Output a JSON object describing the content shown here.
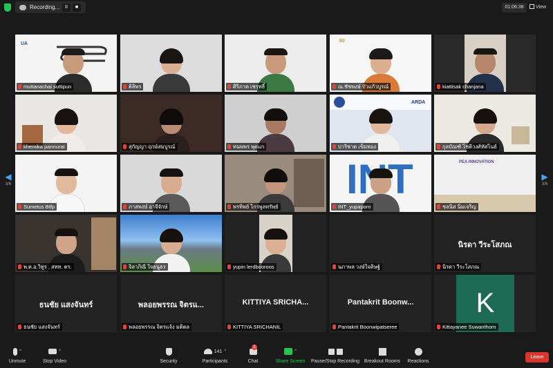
{
  "topbar": {
    "recording_label": "Recording...",
    "pause_symbol": "II",
    "stop_symbol": "■",
    "timer": "01:06:38",
    "view_label": "View"
  },
  "pager": {
    "left_page": "3/6",
    "right_page": "3/6"
  },
  "participants": [
    {
      "name": "muttanachai suttipun",
      "video": true
    },
    {
      "name": "ติลิพร",
      "video": true
    },
    {
      "name": "ศิริภาค เชรุทธิ์",
      "video": true
    },
    {
      "name": "ณ.ชัชพงษ์ บัวแก้วบูรณ์",
      "video": true
    },
    {
      "name": "kiattisak chanjana",
      "video": true
    },
    {
      "name": "khemika pannurat",
      "video": true
    },
    {
      "name": "สุกัญญา ฤกษ์สมบูรณ์",
      "video": true
    },
    {
      "name": "ทนพพร พุดแก",
      "video": true
    },
    {
      "name": "ปาริชาต เข็มทอง",
      "video": true
    },
    {
      "name": "กุลบัณฑ์ โชติวงศ์ทัศไนย์",
      "video": true
    },
    {
      "name": "Sumetus Btfp",
      "video": true
    },
    {
      "name": "ภาสพงษ์ อาจีจักษ์",
      "video": true
    },
    {
      "name": "พรทิพย์ ไกรพูลทรัพย์",
      "video": true
    },
    {
      "name": "INT_yupaporn",
      "video": true
    },
    {
      "name": "ชลนิส นิ่มเจริญ",
      "video": true
    },
    {
      "name": "พ.ต.อ.วิทูร , สทท. ตร.",
      "video": true
    },
    {
      "name": "จิลาภิณี ใจธนูธร",
      "video": true
    },
    {
      "name": "yupin lerdbooroos",
      "video": true
    },
    {
      "name": "นภาพล วงษ์ใจดิษฐ์",
      "video": false,
      "display": ""
    },
    {
      "name": "นิรดา วีระโสภณ",
      "video": false,
      "display": "นิรดา วีระโสภณ"
    },
    {
      "name": "ธนชัย แสงจันทร์",
      "video": false,
      "display": "ธนชัย แสงจันทร์"
    },
    {
      "name": "พลอยพรรณ จิตรแจ้ง มติตล",
      "video": false,
      "display": "พลอยพรรณ จิตรแ..."
    },
    {
      "name": "KITTIYA SRICHANIL",
      "video": false,
      "display": "KITTIYA SRICHA..."
    },
    {
      "name": "Pantakrit Boonwipatseree",
      "video": false,
      "display": "Pantakrit Boonw..."
    },
    {
      "name": "Kittayanee Suwanthorn",
      "video": false,
      "display": "",
      "initial": "K"
    }
  ],
  "slides": {
    "int_logo": "INT",
    "pea_logo": "PEA INNOVATION",
    "arda_logo": "ARDA"
  },
  "toolbar": {
    "unmute": "Unmute",
    "stop_video": "Stop Video",
    "security": "Security",
    "participants": "Participants",
    "participants_count": "141",
    "chat": "Chat",
    "chat_badge": "1",
    "share_screen": "Share Screen",
    "pause_recording": "Pause/Stop Recording",
    "breakout_rooms": "Breakout Rooms",
    "reactions": "Reactions",
    "leave": "Leave"
  },
  "colors": {
    "share_green": "#23c552",
    "leave_red": "#d9362c",
    "nav_blue": "#4aa3f0",
    "k_tile": "#1c6b52"
  }
}
